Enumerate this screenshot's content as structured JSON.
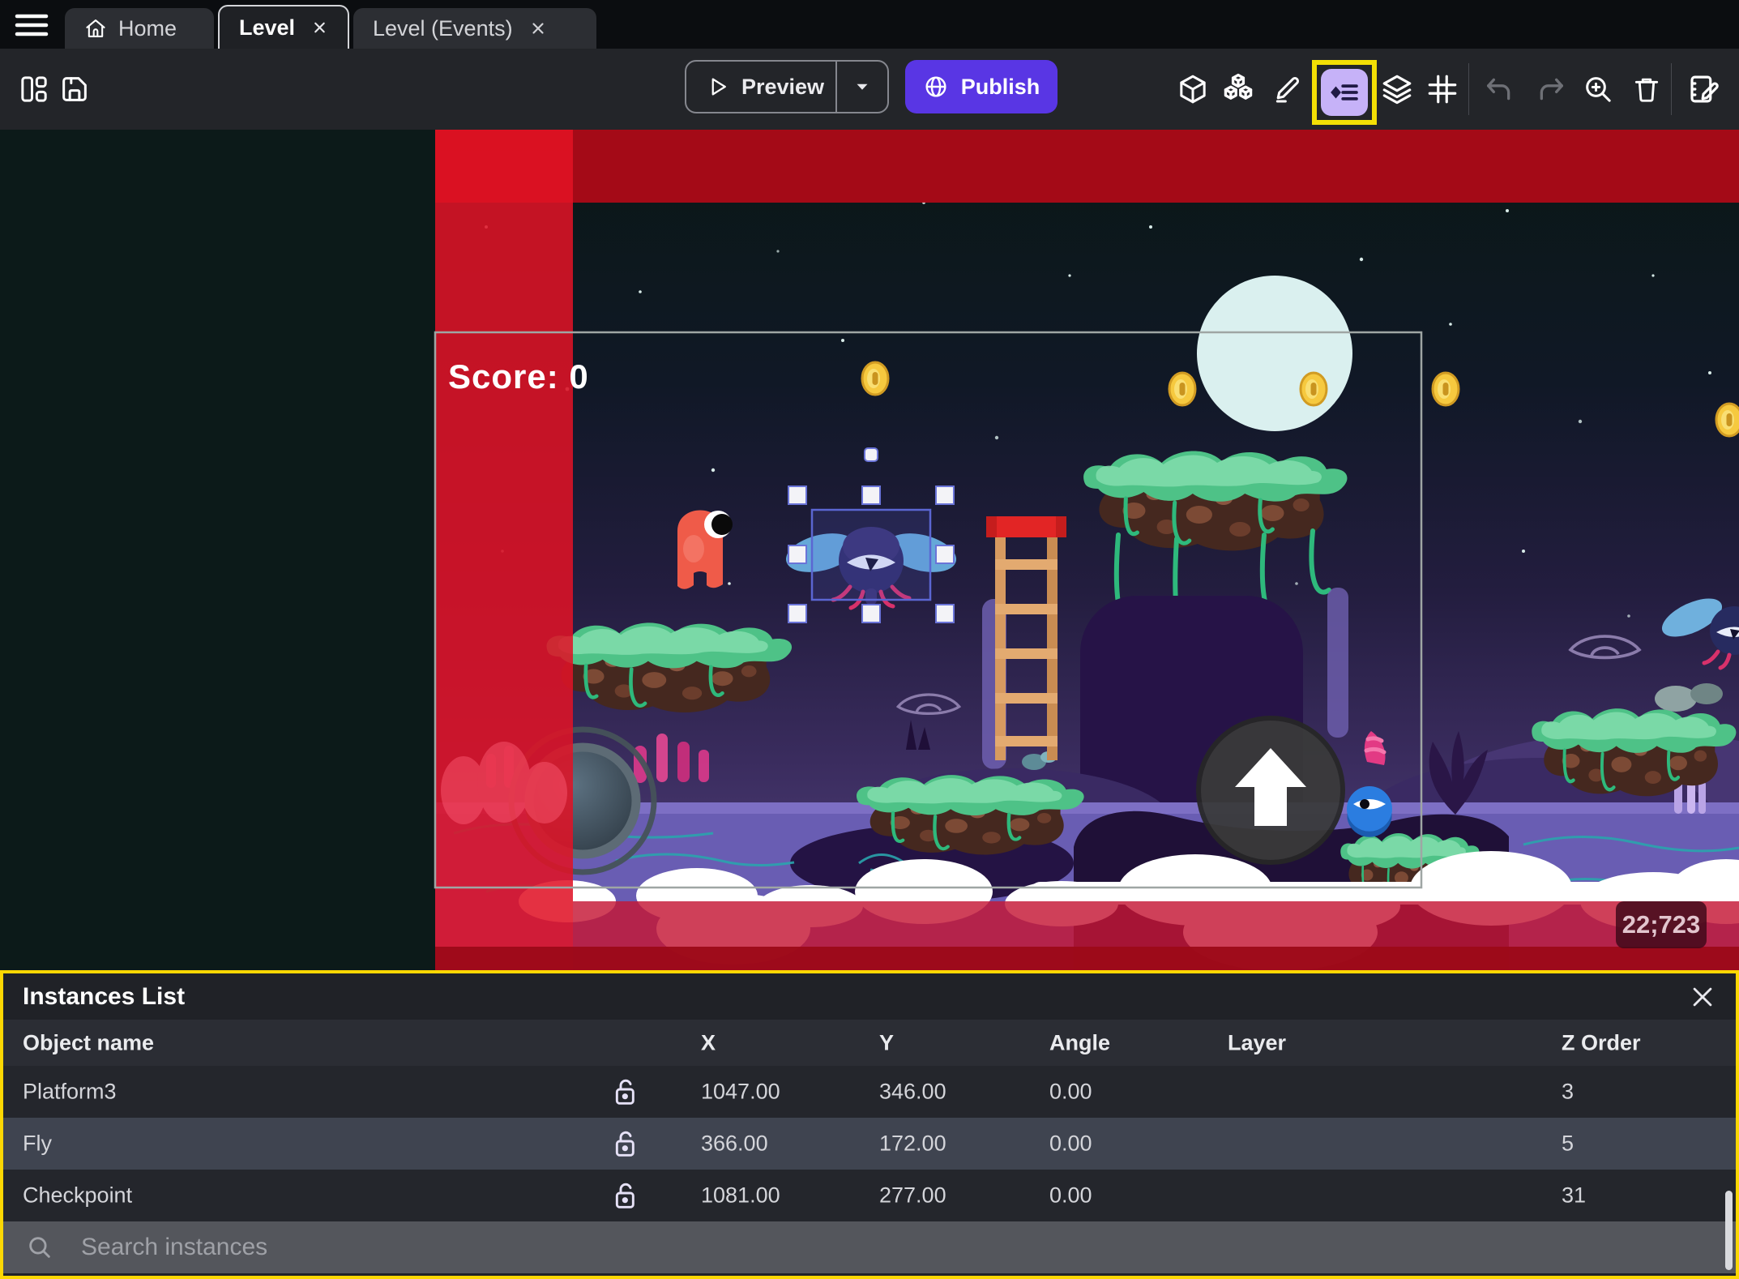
{
  "topbar": {
    "tabs": [
      {
        "label": "Home"
      },
      {
        "label": "Level"
      },
      {
        "label": "Level (Events)"
      }
    ]
  },
  "toolbar": {
    "preview_label": "Preview",
    "publish_label": "Publish"
  },
  "canvas": {
    "score_text": "Score: 0",
    "coords_badge": "22;723"
  },
  "instances_panel": {
    "title": "Instances List",
    "columns": [
      "Object name",
      "X",
      "Y",
      "Angle",
      "Layer",
      "Z Order"
    ],
    "rows": [
      {
        "name": "Platform3",
        "x": "1047.00",
        "y": "346.00",
        "angle": "0.00",
        "layer": "",
        "z_order": "3"
      },
      {
        "name": "Fly",
        "x": "366.00",
        "y": "172.00",
        "angle": "0.00",
        "layer": "",
        "z_order": "5"
      },
      {
        "name": "Checkpoint",
        "x": "1081.00",
        "y": "277.00",
        "angle": "0.00",
        "layer": "",
        "z_order": "31"
      }
    ],
    "selected_row": "Fly",
    "search_placeholder": "Search instances"
  },
  "colors": {
    "accent_purple": "#5936e4",
    "highlight_yellow": "#f3df05",
    "selection_blue": "#5b66d2",
    "selected_row_bg": "#3f4450",
    "camera_bounds_red": "#d61030"
  }
}
